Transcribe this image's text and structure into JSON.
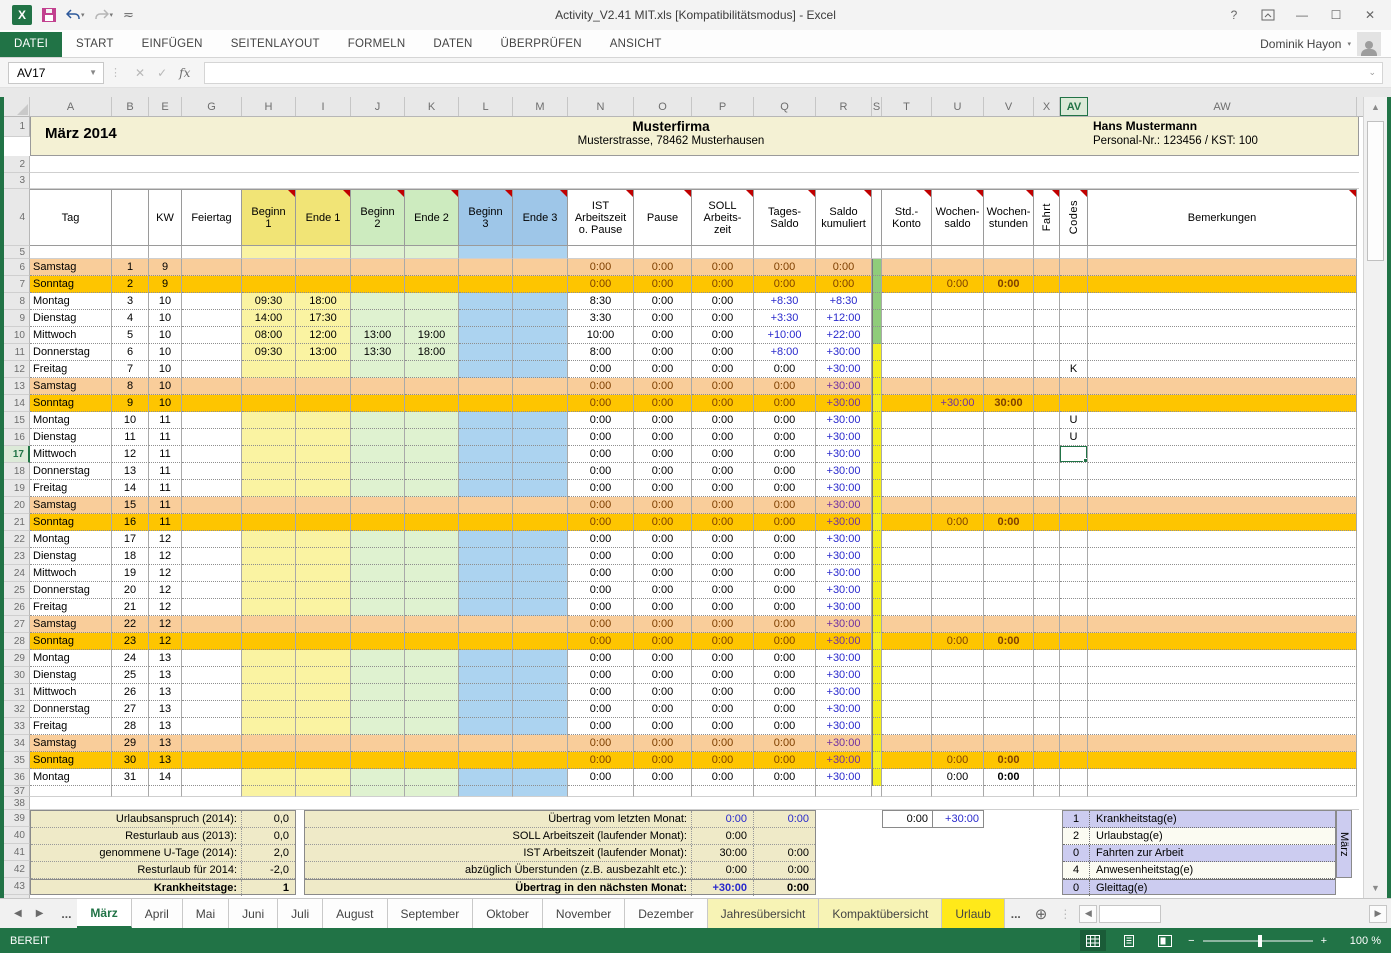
{
  "colors": {
    "accent": "#217346",
    "satBg": "#f9cd9a",
    "sunBg": "#fec500",
    "yBody": "#faf3a2",
    "yHead": "#f1e476",
    "gBody": "#dff2d0",
    "gHead": "#cdebbf",
    "bBody": "#acd3f0",
    "bHead": "#9ec6e8",
    "ivory": "#f4f1d4",
    "sumBg": "#efeac8",
    "lav": "#ccccf0",
    "blue": "#2929cc",
    "purple": "#7030a0",
    "maroon": "#7f4000",
    "stripeGreen": "#8fcc7a",
    "stripeYellow": "#f3ef1d"
  },
  "window": {
    "title": "Activity_V2.41 MIT.xls  [Kompatibilitätsmodus] - Excel",
    "user": "Dominik Hayon",
    "help_label": "?",
    "minimize_label": "—",
    "maximize_label": "☐",
    "close_label": "✕"
  },
  "ribbon": {
    "tabs": [
      {
        "label": "DATEI",
        "active": true
      },
      {
        "label": "START"
      },
      {
        "label": "EINFÜGEN"
      },
      {
        "label": "SEITENLAYOUT"
      },
      {
        "label": "FORMELN"
      },
      {
        "label": "DATEN"
      },
      {
        "label": "ÜBERPRÜFEN"
      },
      {
        "label": "ANSICHT"
      }
    ]
  },
  "formula_bar": {
    "name_box": "AV17",
    "formula": "",
    "fx_label": "fx"
  },
  "sheet": {
    "col_letters": [
      "A",
      "B",
      "E",
      "G",
      "H",
      "I",
      "J",
      "K",
      "L",
      "M",
      "N",
      "O",
      "P",
      "Q",
      "R",
      "S",
      "T",
      "U",
      "V",
      "X",
      "AV",
      "AW"
    ],
    "selected_col": "AV",
    "selected_row": "17",
    "title_block": {
      "month": "März 2014",
      "company": "Musterfirma",
      "address": "Musterstrasse, 78462 Musterhausen",
      "employee": "Hans Mustermann",
      "personal": "Personal-Nr.: 123456 / KST: 100"
    },
    "header_row": {
      "tag": "Tag",
      "kw": "KW",
      "fei": "Feiertag",
      "b1": "Beginn\n1",
      "e1": "Ende 1",
      "b2": "Beginn\n2",
      "e2": "Ende 2",
      "b3": "Beginn\n3",
      "e3": "Ende 3",
      "ist": "IST\nArbeitszeit\no. Pause",
      "pause": "Pause",
      "soll": "SOLL\nArbeits-\nzeit",
      "ts": "Tages-\nSaldo",
      "ks": "Saldo\nkumuliert",
      "tk": "Std.-\nKonto",
      "ws": "Wochen-\nsaldo",
      "wh": "Wochen-\nstunden",
      "fahrt": "Fahrt",
      "code": "Codes",
      "bem": "Bemerkungen"
    },
    "rows": [
      {
        "n": "6",
        "day": "Samstag",
        "d": "1",
        "kw": "9",
        "t": "sat",
        "st": "g",
        "ist": "0:00",
        "pa": "0:00",
        "so": "0:00",
        "ts": "0:00",
        "ks": "0:00"
      },
      {
        "n": "7",
        "day": "Sonntag",
        "d": "2",
        "kw": "9",
        "t": "sun",
        "st": "g",
        "ist": "0:00",
        "pa": "0:00",
        "so": "0:00",
        "ts": "0:00",
        "ks": "0:00",
        "ws": "0:00",
        "wh": "0:00"
      },
      {
        "n": "8",
        "day": "Montag",
        "d": "3",
        "kw": "10",
        "t": "wd",
        "st": "g",
        "b1": "09:30",
        "e1": "18:00",
        "ist": "8:30",
        "pa": "0:00",
        "so": "0:00",
        "ts": "+8:30",
        "ks": "+8:30"
      },
      {
        "n": "9",
        "day": "Dienstag",
        "d": "4",
        "kw": "10",
        "t": "wd",
        "st": "g",
        "b1": "14:00",
        "e1": "17:30",
        "ist": "3:30",
        "pa": "0:00",
        "so": "0:00",
        "ts": "+3:30",
        "ks": "+12:00"
      },
      {
        "n": "10",
        "day": "Mittwoch",
        "d": "5",
        "kw": "10",
        "t": "wd",
        "st": "g",
        "b1": "08:00",
        "e1": "12:00",
        "b2": "13:00",
        "e2": "19:00",
        "ist": "10:00",
        "pa": "0:00",
        "so": "0:00",
        "ts": "+10:00",
        "ks": "+22:00"
      },
      {
        "n": "11",
        "day": "Donnerstag",
        "d": "6",
        "kw": "10",
        "t": "wd",
        "st": "y",
        "b1": "09:30",
        "e1": "13:00",
        "b2": "13:30",
        "e2": "18:00",
        "ist": "8:00",
        "pa": "0:00",
        "so": "0:00",
        "ts": "+8:00",
        "ks": "+30:00"
      },
      {
        "n": "12",
        "day": "Freitag",
        "d": "7",
        "kw": "10",
        "t": "wd",
        "st": "y",
        "ist": "0:00",
        "pa": "0:00",
        "so": "0:00",
        "ts": "0:00",
        "ks": "+30:00",
        "code": "K"
      },
      {
        "n": "13",
        "day": "Samstag",
        "d": "8",
        "kw": "10",
        "t": "sat",
        "st": "y",
        "ist": "0:00",
        "pa": "0:00",
        "so": "0:00",
        "ts": "0:00",
        "ks": "+30:00"
      },
      {
        "n": "14",
        "day": "Sonntag",
        "d": "9",
        "kw": "10",
        "t": "sun",
        "st": "y",
        "ist": "0:00",
        "pa": "0:00",
        "so": "0:00",
        "ts": "0:00",
        "ks": "+30:00",
        "ws": "+30:00",
        "wh": "30:00"
      },
      {
        "n": "15",
        "day": "Montag",
        "d": "10",
        "kw": "11",
        "t": "wd",
        "st": "y",
        "ist": "0:00",
        "pa": "0:00",
        "so": "0:00",
        "ts": "0:00",
        "ks": "+30:00",
        "code": "U"
      },
      {
        "n": "16",
        "day": "Dienstag",
        "d": "11",
        "kw": "11",
        "t": "wd",
        "st": "y",
        "ist": "0:00",
        "pa": "0:00",
        "so": "0:00",
        "ts": "0:00",
        "ks": "+30:00",
        "code": "U"
      },
      {
        "n": "17",
        "day": "Mittwoch",
        "d": "12",
        "kw": "11",
        "t": "wd",
        "st": "y",
        "ist": "0:00",
        "pa": "0:00",
        "so": "0:00",
        "ts": "0:00",
        "ks": "+30:00",
        "sel": true
      },
      {
        "n": "18",
        "day": "Donnerstag",
        "d": "13",
        "kw": "11",
        "t": "wd",
        "st": "y",
        "ist": "0:00",
        "pa": "0:00",
        "so": "0:00",
        "ts": "0:00",
        "ks": "+30:00"
      },
      {
        "n": "19",
        "day": "Freitag",
        "d": "14",
        "kw": "11",
        "t": "wd",
        "st": "y",
        "ist": "0:00",
        "pa": "0:00",
        "so": "0:00",
        "ts": "0:00",
        "ks": "+30:00"
      },
      {
        "n": "20",
        "day": "Samstag",
        "d": "15",
        "kw": "11",
        "t": "sat",
        "st": "y",
        "ist": "0:00",
        "pa": "0:00",
        "so": "0:00",
        "ts": "0:00",
        "ks": "+30:00"
      },
      {
        "n": "21",
        "day": "Sonntag",
        "d": "16",
        "kw": "11",
        "t": "sun",
        "st": "y",
        "ist": "0:00",
        "pa": "0:00",
        "so": "0:00",
        "ts": "0:00",
        "ks": "+30:00",
        "ws": "0:00",
        "wh": "0:00"
      },
      {
        "n": "22",
        "day": "Montag",
        "d": "17",
        "kw": "12",
        "t": "wd",
        "st": "y",
        "ist": "0:00",
        "pa": "0:00",
        "so": "0:00",
        "ts": "0:00",
        "ks": "+30:00"
      },
      {
        "n": "23",
        "day": "Dienstag",
        "d": "18",
        "kw": "12",
        "t": "wd",
        "st": "y",
        "ist": "0:00",
        "pa": "0:00",
        "so": "0:00",
        "ts": "0:00",
        "ks": "+30:00"
      },
      {
        "n": "24",
        "day": "Mittwoch",
        "d": "19",
        "kw": "12",
        "t": "wd",
        "st": "y",
        "ist": "0:00",
        "pa": "0:00",
        "so": "0:00",
        "ts": "0:00",
        "ks": "+30:00"
      },
      {
        "n": "25",
        "day": "Donnerstag",
        "d": "20",
        "kw": "12",
        "t": "wd",
        "st": "y",
        "ist": "0:00",
        "pa": "0:00",
        "so": "0:00",
        "ts": "0:00",
        "ks": "+30:00"
      },
      {
        "n": "26",
        "day": "Freitag",
        "d": "21",
        "kw": "12",
        "t": "wd",
        "st": "y",
        "ist": "0:00",
        "pa": "0:00",
        "so": "0:00",
        "ts": "0:00",
        "ks": "+30:00"
      },
      {
        "n": "27",
        "day": "Samstag",
        "d": "22",
        "kw": "12",
        "t": "sat",
        "st": "y",
        "ist": "0:00",
        "pa": "0:00",
        "so": "0:00",
        "ts": "0:00",
        "ks": "+30:00"
      },
      {
        "n": "28",
        "day": "Sonntag",
        "d": "23",
        "kw": "12",
        "t": "sun",
        "st": "y",
        "ist": "0:00",
        "pa": "0:00",
        "so": "0:00",
        "ts": "0:00",
        "ks": "+30:00",
        "ws": "0:00",
        "wh": "0:00"
      },
      {
        "n": "29",
        "day": "Montag",
        "d": "24",
        "kw": "13",
        "t": "wd",
        "st": "y",
        "ist": "0:00",
        "pa": "0:00",
        "so": "0:00",
        "ts": "0:00",
        "ks": "+30:00"
      },
      {
        "n": "30",
        "day": "Dienstag",
        "d": "25",
        "kw": "13",
        "t": "wd",
        "st": "y",
        "ist": "0:00",
        "pa": "0:00",
        "so": "0:00",
        "ts": "0:00",
        "ks": "+30:00"
      },
      {
        "n": "31",
        "day": "Mittwoch",
        "d": "26",
        "kw": "13",
        "t": "wd",
        "st": "y",
        "ist": "0:00",
        "pa": "0:00",
        "so": "0:00",
        "ts": "0:00",
        "ks": "+30:00"
      },
      {
        "n": "32",
        "day": "Donnerstag",
        "d": "27",
        "kw": "13",
        "t": "wd",
        "st": "y",
        "ist": "0:00",
        "pa": "0:00",
        "so": "0:00",
        "ts": "0:00",
        "ks": "+30:00"
      },
      {
        "n": "33",
        "day": "Freitag",
        "d": "28",
        "kw": "13",
        "t": "wd",
        "st": "y",
        "ist": "0:00",
        "pa": "0:00",
        "so": "0:00",
        "ts": "0:00",
        "ks": "+30:00"
      },
      {
        "n": "34",
        "day": "Samstag",
        "d": "29",
        "kw": "13",
        "t": "sat",
        "st": "y",
        "ist": "0:00",
        "pa": "0:00",
        "so": "0:00",
        "ts": "0:00",
        "ks": "+30:00"
      },
      {
        "n": "35",
        "day": "Sonntag",
        "d": "30",
        "kw": "13",
        "t": "sun",
        "st": "y",
        "ist": "0:00",
        "pa": "0:00",
        "so": "0:00",
        "ts": "0:00",
        "ks": "+30:00",
        "ws": "0:00",
        "wh": "0:00"
      },
      {
        "n": "36",
        "day": "Montag",
        "d": "31",
        "kw": "14",
        "t": "wd",
        "st": "y",
        "ist": "0:00",
        "pa": "0:00",
        "so": "0:00",
        "ts": "0:00",
        "ks": "+30:00",
        "ws": "0:00",
        "wh": "0:00"
      }
    ]
  },
  "summary": {
    "left": {
      "labels": [
        "Urlaubsanspruch (2014):",
        "Resturlaub aus (2013):",
        "genommene U-Tage (2014):",
        "Resturlaub für 2014:",
        "Krankheitstage:"
      ],
      "values": [
        "0,0",
        "0,0",
        "2,0",
        "-2,0",
        "1"
      ]
    },
    "middle": {
      "labels": [
        "Übertrag vom letzten Monat:",
        "SOLL Arbeitszeit (laufender Monat):",
        "IST Arbeitszeit (laufender Monat):",
        "abzüglich Überstunden (z.B. ausbezahlt etc.):",
        "Übertrag in den nächsten Monat:"
      ],
      "val1": [
        "0:00",
        "0:00",
        "30:00",
        "0:00",
        "+30:00"
      ],
      "val2": [
        "0:00",
        "",
        "0:00",
        "0:00",
        "0:00"
      ]
    },
    "std_box": {
      "val1": "0:00",
      "val2": "+30:00"
    },
    "legend": {
      "rows": [
        [
          "1",
          "Krankheitstag(e)"
        ],
        [
          "2",
          "Urlaubstag(e)"
        ],
        [
          "0",
          "Fahrten zur Arbeit"
        ],
        [
          "4",
          "Anwesenheitstag(e)"
        ],
        [
          "0",
          "Gleittag(e)"
        ]
      ],
      "side_label": "März"
    }
  },
  "tabs_bar": {
    "overflow": "...",
    "tabs": [
      {
        "label": "März",
        "state": "active"
      },
      {
        "label": "April"
      },
      {
        "label": "Mai"
      },
      {
        "label": "Juni"
      },
      {
        "label": "Juli"
      },
      {
        "label": "August"
      },
      {
        "label": "September"
      },
      {
        "label": "Oktober"
      },
      {
        "label": "November"
      },
      {
        "label": "Dezember"
      },
      {
        "label": "Jahresübersicht",
        "state": "pale"
      },
      {
        "label": "Kompaktübersicht",
        "state": "pale"
      },
      {
        "label": "Urlaub",
        "state": "yellow"
      }
    ],
    "add_label": "+"
  },
  "status_bar": {
    "ready": "BEREIT",
    "zoom": "100 %"
  }
}
